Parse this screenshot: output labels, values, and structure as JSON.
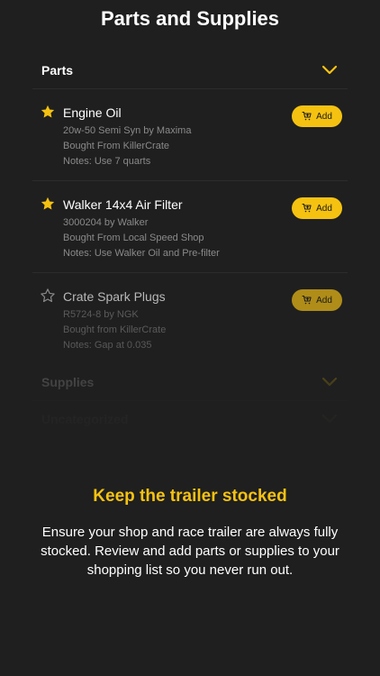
{
  "header": {
    "title": "Parts and Supplies"
  },
  "sections": [
    {
      "label": "Parts",
      "expanded": true,
      "items": [
        {
          "name": "Engine Oil",
          "line1": "20w-50 Semi Syn by Maxima",
          "line2": "Bought From KillerCrate",
          "line3": "Notes: Use 7 quarts",
          "starred": true,
          "add_label": "Add"
        },
        {
          "name": "Walker 14x4 Air Filter",
          "line1": "3000204 by Walker",
          "line2": "Bought From Local Speed Shop",
          "line3": "Notes: Use Walker Oil and Pre-filter",
          "starred": true,
          "add_label": "Add"
        },
        {
          "name": "Crate Spark Plugs",
          "line1": "R5724-8 by NGK",
          "line2": "Bought from KillerCrate",
          "line3": "Notes: Gap at 0.035",
          "starred": false,
          "add_label": "Add"
        }
      ]
    },
    {
      "label": "Supplies",
      "expanded": false
    },
    {
      "label": "Uncategorized",
      "expanded": false
    }
  ],
  "promo": {
    "title": "Keep the trailer stocked",
    "body": "Ensure your shop and race trailer are always fully stocked. Review and add parts or supplies to your shopping list so you never run out."
  },
  "colors": {
    "accent": "#f5c211",
    "background": "#1f1f1f"
  },
  "icons": {
    "expand": "chevron-down-icon",
    "star_filled": "star-filled-icon",
    "star_outline": "star-outline-icon",
    "cart": "cart-plus-icon"
  }
}
